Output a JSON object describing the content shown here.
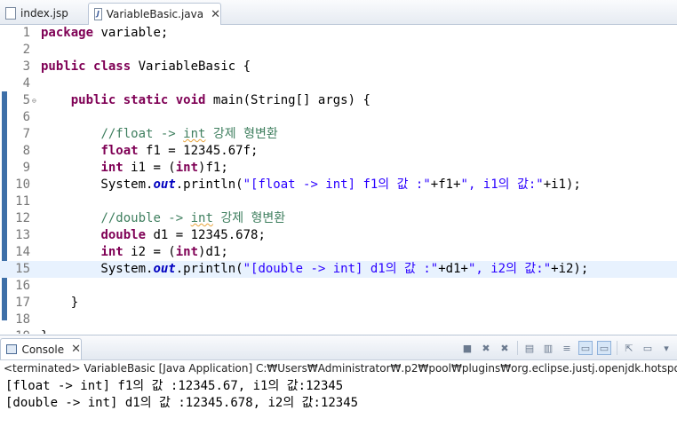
{
  "tabs": [
    {
      "label": "index.jsp",
      "icon": "jsp-file-icon",
      "active": false
    },
    {
      "label": "VariableBasic.java",
      "icon": "java-file-icon",
      "active": true
    }
  ],
  "editor": {
    "current_line": 15,
    "lines": [
      {
        "n": "1",
        "code": "package variable;"
      },
      {
        "n": "2",
        "code": ""
      },
      {
        "n": "3",
        "code": "public class VariableBasic {"
      },
      {
        "n": "4",
        "code": ""
      },
      {
        "n": "5",
        "code": "    public static void main(String[] args) {"
      },
      {
        "n": "6",
        "code": ""
      },
      {
        "n": "7",
        "code": "        //float -> int 강제 형변환"
      },
      {
        "n": "8",
        "code": "        float f1 = 12345.67f;"
      },
      {
        "n": "9",
        "code": "        int i1 = (int)f1;"
      },
      {
        "n": "10",
        "code": "        System.out.println(\"[float -> int] f1의 값 :\"+f1+\", i1의 값:\"+i1);"
      },
      {
        "n": "11",
        "code": ""
      },
      {
        "n": "12",
        "code": "        //double -> int 강제 형변환"
      },
      {
        "n": "13",
        "code": "        double d1 = 12345.678;"
      },
      {
        "n": "14",
        "code": "        int i2 = (int)d1;"
      },
      {
        "n": "15",
        "code": "        System.out.println(\"[double -> int] d1의 값 :\"+d1+\", i2의 값:\"+i2);"
      },
      {
        "n": "16",
        "code": ""
      },
      {
        "n": "17",
        "code": "    }"
      },
      {
        "n": "18",
        "code": ""
      },
      {
        "n": "19",
        "code": "}"
      }
    ]
  },
  "console": {
    "tab_label": "Console",
    "status": "<terminated> VariableBasic [Java Application] C:₩Users₩Administrator₩.p2₩pool₩plugins₩org.eclipse.justj.openjdk.hotspot.jre.full.win32.x8",
    "output": [
      "[float -> int] f1의 값 :12345.67, i1의 값:12345",
      "[double -> int] d1의 값 :12345.678, i2의 값:12345"
    ],
    "toolbar": [
      "terminate-icon",
      "remove-launch-icon",
      "remove-all-terminated-icon",
      "clear-console-icon",
      "scroll-lock-icon",
      "word-wrap-icon",
      "show-on-stdout-icon",
      "show-on-stderr-icon",
      "pin-console-icon",
      "display-console-icon",
      "dropdown-icon"
    ]
  },
  "colors": {
    "keyword": "#7f0055",
    "comment": "#3f7f5f",
    "string": "#2a00ff",
    "field": "#0000c0",
    "ruler": "#3d6fa8"
  }
}
